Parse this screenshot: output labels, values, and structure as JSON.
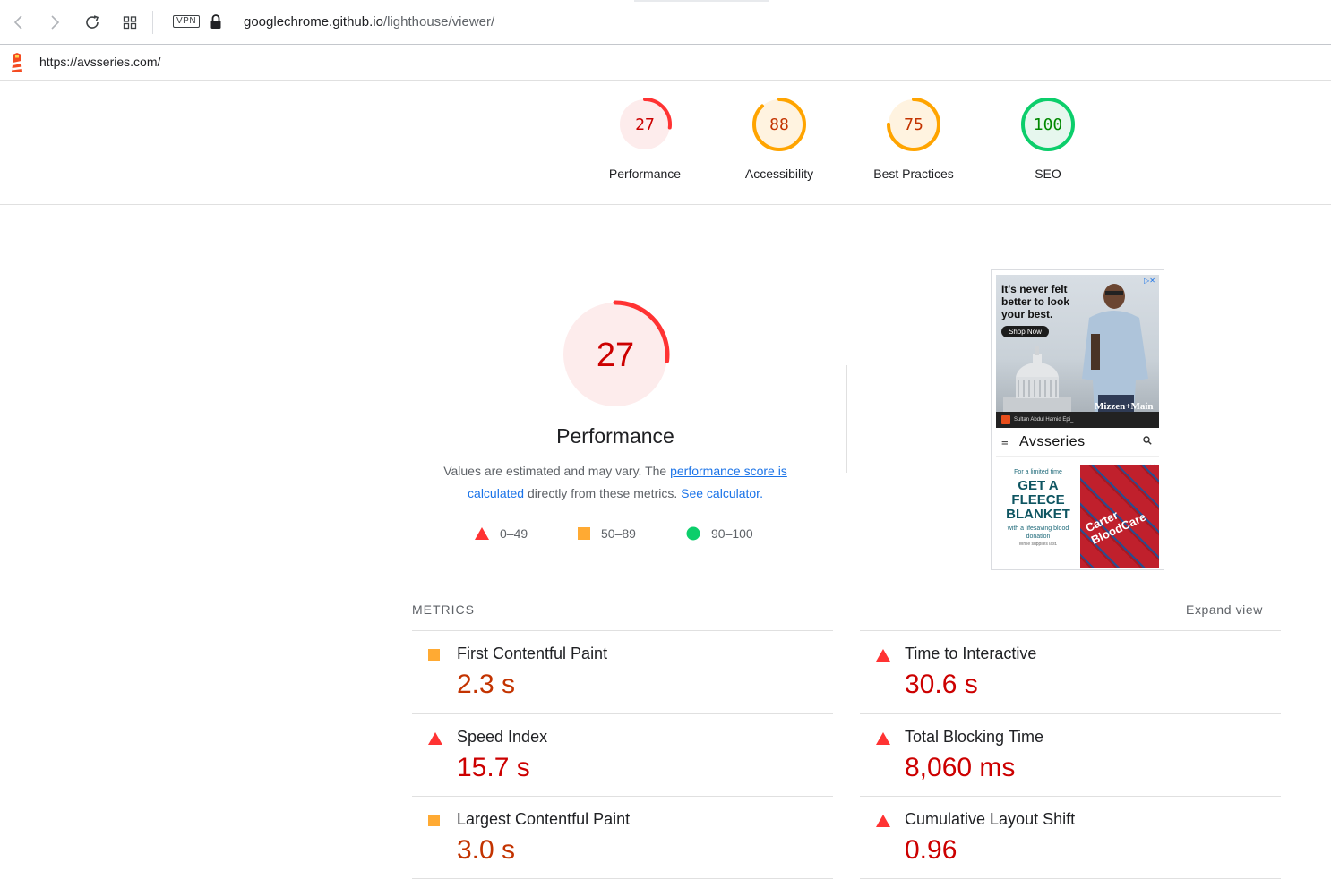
{
  "browser": {
    "vpn_label": "VPN",
    "url_host": "googlechrome.github.io",
    "url_path": "/lighthouse/viewer/"
  },
  "lighthouse": {
    "tested_url": "https://avsseries.com/"
  },
  "scores": [
    {
      "label": "Performance",
      "value": 27,
      "status": "fail"
    },
    {
      "label": "Accessibility",
      "value": 88,
      "status": "average"
    },
    {
      "label": "Best Practices",
      "value": 75,
      "status": "average"
    },
    {
      "label": "SEO",
      "value": 100,
      "status": "pass"
    }
  ],
  "performance": {
    "score": 27,
    "title": "Performance",
    "desc_prefix": "Values are estimated and may vary. The ",
    "desc_link1": "performance score is calculated",
    "desc_middle": " directly from these metrics. ",
    "desc_link2": "See calculator.",
    "legend": [
      {
        "range": "0–49",
        "shape": "triangle",
        "color": "#ff3333"
      },
      {
        "range": "50–89",
        "shape": "square",
        "color": "#ffaa33"
      },
      {
        "range": "90–100",
        "shape": "circle",
        "color": "#0cce6b"
      }
    ]
  },
  "screenshot": {
    "ad1_headline": "It's never felt better to look your best.",
    "ad1_cta": "Shop Now",
    "ad1_brand": "Mizzen+Main",
    "ad1_caption": "Sultan Abdul Hamid Epi_",
    "site_name": "Avsseries",
    "ad2_small": "For a limited time",
    "ad2_big": "GET A FLEECE BLANKET",
    "ad2_sub": "with a lifesaving blood donation",
    "ad2_sub2": "While supplies last.",
    "ad2_brand": "Carter BloodCare"
  },
  "metrics": {
    "header": "METRICS",
    "expand": "Expand view",
    "items": [
      {
        "title": "First Contentful Paint",
        "value": "2.3 s",
        "status": "average"
      },
      {
        "title": "Time to Interactive",
        "value": "30.6 s",
        "status": "fail"
      },
      {
        "title": "Speed Index",
        "value": "15.7 s",
        "status": "fail"
      },
      {
        "title": "Total Blocking Time",
        "value": "8,060 ms",
        "status": "fail"
      },
      {
        "title": "Largest Contentful Paint",
        "value": "3.0 s",
        "status": "average"
      },
      {
        "title": "Cumulative Layout Shift",
        "value": "0.96",
        "status": "fail"
      }
    ]
  },
  "colors": {
    "fail": "#ff3333",
    "fail_text": "#cc0000",
    "fail_bg": "#fdecec",
    "average": "#ffa400",
    "average_text": "#c33300",
    "average_bg": "#fff3e0",
    "pass": "#0cce6b",
    "pass_text": "#008800",
    "pass_bg": "#e6f7ee"
  }
}
